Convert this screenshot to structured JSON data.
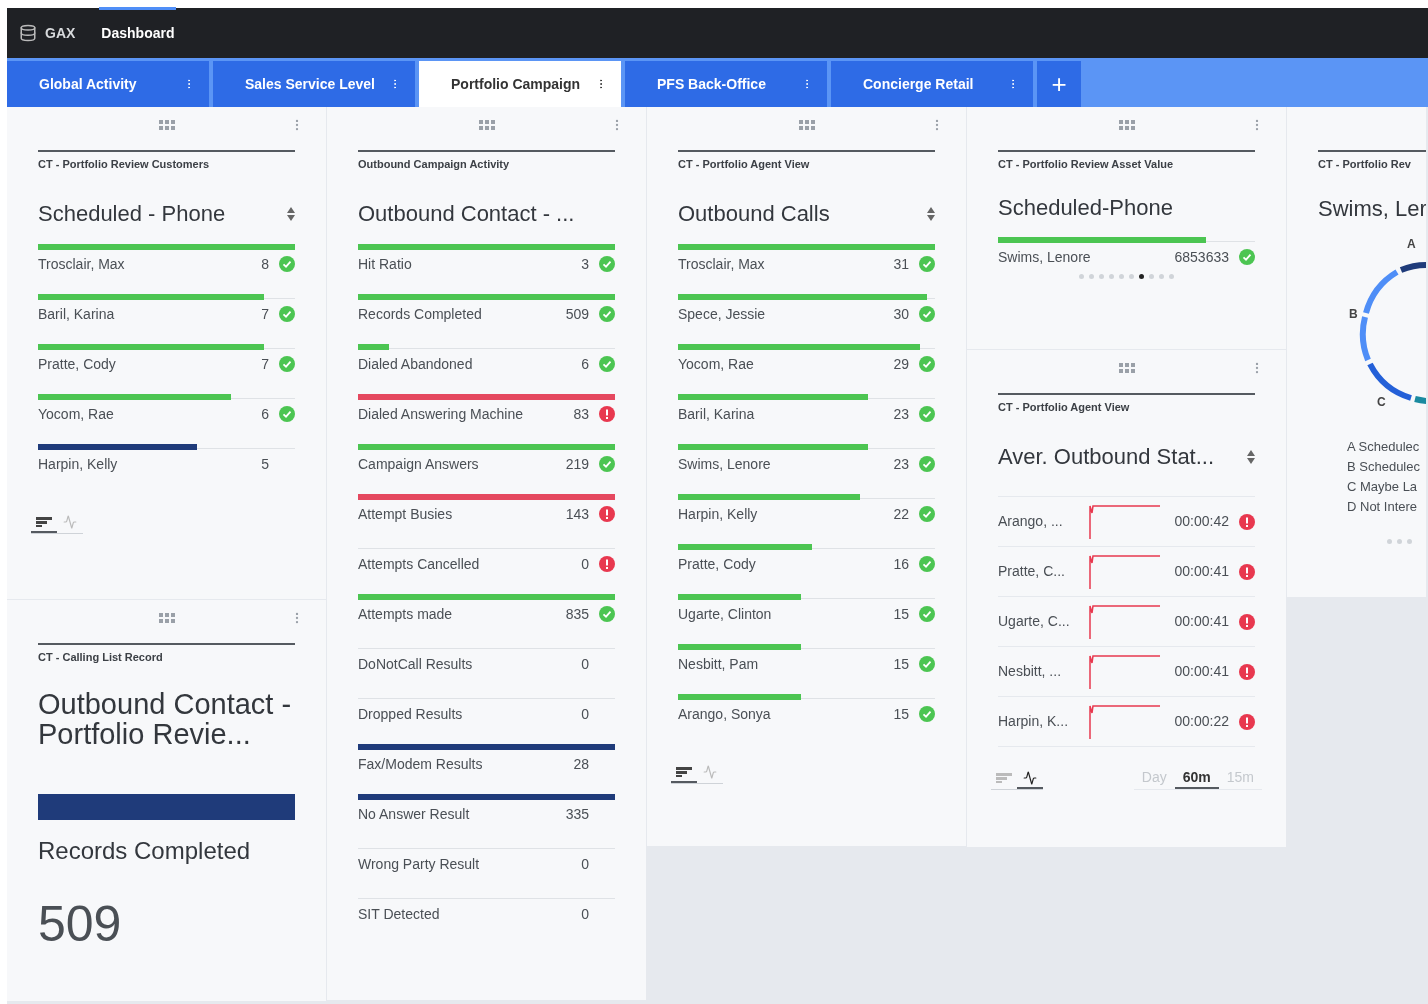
{
  "topbar": {
    "brand": "GAX",
    "title": "Dashboard"
  },
  "tabs": [
    {
      "label": "Global Activity",
      "selected": false
    },
    {
      "label": "Sales Service Level",
      "selected": false
    },
    {
      "label": "Portfolio Campaign",
      "selected": true
    },
    {
      "label": "PFS Back-Office",
      "selected": false
    },
    {
      "label": "Concierge Retail",
      "selected": false
    }
  ],
  "add_tab": "+",
  "columns": [
    {
      "widgets": [
        {
          "kind": "bars",
          "category": "CT - Portfolio Review Customers",
          "title": "Scheduled - Phone",
          "sortable": true,
          "rows": [
            {
              "label": "Trosclair, Max",
              "value": "8",
              "level": 1,
              "color": "#4cc552",
              "kind": "ok"
            },
            {
              "label": "Baril, Karina",
              "value": "7",
              "level": 0.88,
              "color": "#4cc552",
              "kind": "ok"
            },
            {
              "label": "Pratte, Cody",
              "value": "7",
              "level": 0.88,
              "color": "#4cc552",
              "kind": "ok"
            },
            {
              "label": "Yocom, Rae",
              "value": "6",
              "level": 0.75,
              "color": "#4cc552",
              "kind": "ok"
            },
            {
              "label": "Harpin, Kelly",
              "value": "5",
              "level": 0.62,
              "color": "#1f3b7a",
              "kind": "plain"
            }
          ],
          "views": [
            {
              "kind": "bars",
              "selected": true
            },
            {
              "kind": "trend",
              "selected": false
            }
          ]
        },
        {
          "kind": "kpi",
          "category": "CT - Calling List Record",
          "title": "Outbound Contact - Portfolio Revie...",
          "metric": "Records Completed",
          "value": "509"
        }
      ]
    },
    {
      "widgets": [
        {
          "kind": "bars",
          "category": "Outbound Campaign Activity",
          "title": "Outbound Contact - ...",
          "sortable": false,
          "rows": [
            {
              "label": "Hit Ratio",
              "value": "3",
              "level": 1,
              "color": "#4cc552",
              "kind": "ok"
            },
            {
              "label": "Records Completed",
              "value": "509",
              "level": 1,
              "color": "#4cc552",
              "kind": "ok"
            },
            {
              "label": "Dialed Abandoned",
              "value": "6",
              "level": 0.12,
              "color": "#4cc552",
              "kind": "ok"
            },
            {
              "label": "Dialed Answering Machine",
              "value": "83",
              "level": 1,
              "color": "#e5485f",
              "kind": "alert"
            },
            {
              "label": "Campaign Answers",
              "value": "219",
              "level": 1,
              "color": "#4cc552",
              "kind": "ok"
            },
            {
              "label": "Attempt Busies",
              "value": "143",
              "level": 1,
              "color": "#e5485f",
              "kind": "alert"
            },
            {
              "label": "Attempts Cancelled",
              "value": "0",
              "level": 0,
              "kind": "alert"
            },
            {
              "label": "Attempts made",
              "value": "835",
              "level": 1,
              "color": "#4cc552",
              "kind": "ok"
            },
            {
              "label": "DoNotCall Results",
              "value": "0",
              "level": 0,
              "kind": "plain"
            },
            {
              "label": "Dropped Results",
              "value": "0",
              "level": 0,
              "kind": "plain"
            },
            {
              "label": "Fax/Modem Results",
              "value": "28",
              "level": 1,
              "color": "#1f3b7a",
              "kind": "plain"
            },
            {
              "label": "No Answer Result",
              "value": "335",
              "level": 1,
              "color": "#1f3b7a",
              "kind": "plain"
            },
            {
              "label": "Wrong Party Result",
              "value": "0",
              "level": 0,
              "kind": "plain"
            },
            {
              "label": "SIT Detected",
              "value": "0",
              "level": 0,
              "kind": "plain"
            }
          ]
        }
      ]
    },
    {
      "widgets": [
        {
          "kind": "bars",
          "category": "CT - Portfolio Agent View",
          "title": "Outbound Calls",
          "sortable": true,
          "rows": [
            {
              "label": "Trosclair, Max",
              "value": "31",
              "level": 1,
              "color": "#4cc552",
              "kind": "ok"
            },
            {
              "label": "Spece, Jessie",
              "value": "30",
              "level": 0.97,
              "color": "#4cc552",
              "kind": "ok"
            },
            {
              "label": "Yocom, Rae",
              "value": "29",
              "level": 0.94,
              "color": "#4cc552",
              "kind": "ok"
            },
            {
              "label": "Baril, Karina",
              "value": "23",
              "level": 0.74,
              "color": "#4cc552",
              "kind": "ok"
            },
            {
              "label": "Swims, Lenore",
              "value": "23",
              "level": 0.74,
              "color": "#4cc552",
              "kind": "ok"
            },
            {
              "label": "Harpin, Kelly",
              "value": "22",
              "level": 0.71,
              "color": "#4cc552",
              "kind": "ok"
            },
            {
              "label": "Pratte, Cody",
              "value": "16",
              "level": 0.52,
              "color": "#4cc552",
              "kind": "ok"
            },
            {
              "label": "Ugarte, Clinton",
              "value": "15",
              "level": 0.48,
              "color": "#4cc552",
              "kind": "ok"
            },
            {
              "label": "Nesbitt, Pam",
              "value": "15",
              "level": 0.48,
              "color": "#4cc552",
              "kind": "ok"
            },
            {
              "label": "Arango, Sonya",
              "value": "15",
              "level": 0.48,
              "color": "#4cc552",
              "kind": "ok"
            }
          ],
          "views": [
            {
              "kind": "bars",
              "selected": true
            },
            {
              "kind": "trend",
              "selected": false
            }
          ]
        }
      ]
    },
    {
      "widgets": [
        {
          "kind": "bars",
          "category": "CT - Portfolio Review Asset Value",
          "title": "Scheduled-Phone",
          "sortable": false,
          "rows": [
            {
              "label": "Swims, Lenore",
              "value": "6853633",
              "level": 0.81,
              "color": "#4cc552",
              "kind": "ok"
            }
          ],
          "pages": [
            {
              "selected": false
            },
            {
              "selected": false
            },
            {
              "selected": false
            },
            {
              "selected": false
            },
            {
              "selected": false
            },
            {
              "selected": false
            },
            {
              "selected": true
            },
            {
              "selected": false
            },
            {
              "selected": false
            },
            {
              "selected": false
            }
          ]
        },
        {
          "kind": "trend",
          "category": "CT - Portfolio Agent View",
          "title": "Aver. Outbound Stat...",
          "sortable": true,
          "rows": [
            {
              "label": "Arango, ...",
              "value": "00:00:42",
              "kind": "alert"
            },
            {
              "label": "Pratte, C...",
              "value": "00:00:41",
              "kind": "alert"
            },
            {
              "label": "Ugarte, C...",
              "value": "00:00:41",
              "kind": "alert"
            },
            {
              "label": "Nesbitt, ...",
              "value": "00:00:41",
              "kind": "alert"
            },
            {
              "label": "Harpin, K...",
              "value": "00:00:22",
              "kind": "alert"
            }
          ],
          "views": [
            {
              "kind": "bars",
              "selected": false
            },
            {
              "kind": "trend",
              "selected": true
            }
          ],
          "ranges": [
            {
              "label": "Day",
              "selected": false
            },
            {
              "label": "60m",
              "selected": true
            },
            {
              "label": "15m",
              "selected": false
            }
          ]
        }
      ]
    },
    {
      "widgets": [
        {
          "kind": "donut",
          "category": "CT - Portfolio Rev",
          "title": "Swims, Ler",
          "labels": [
            "A",
            "B",
            "C"
          ],
          "legend": [
            "A Schedulec",
            "B Schedulec",
            "C Maybe La",
            "D Not Intere"
          ]
        }
      ]
    }
  ]
}
